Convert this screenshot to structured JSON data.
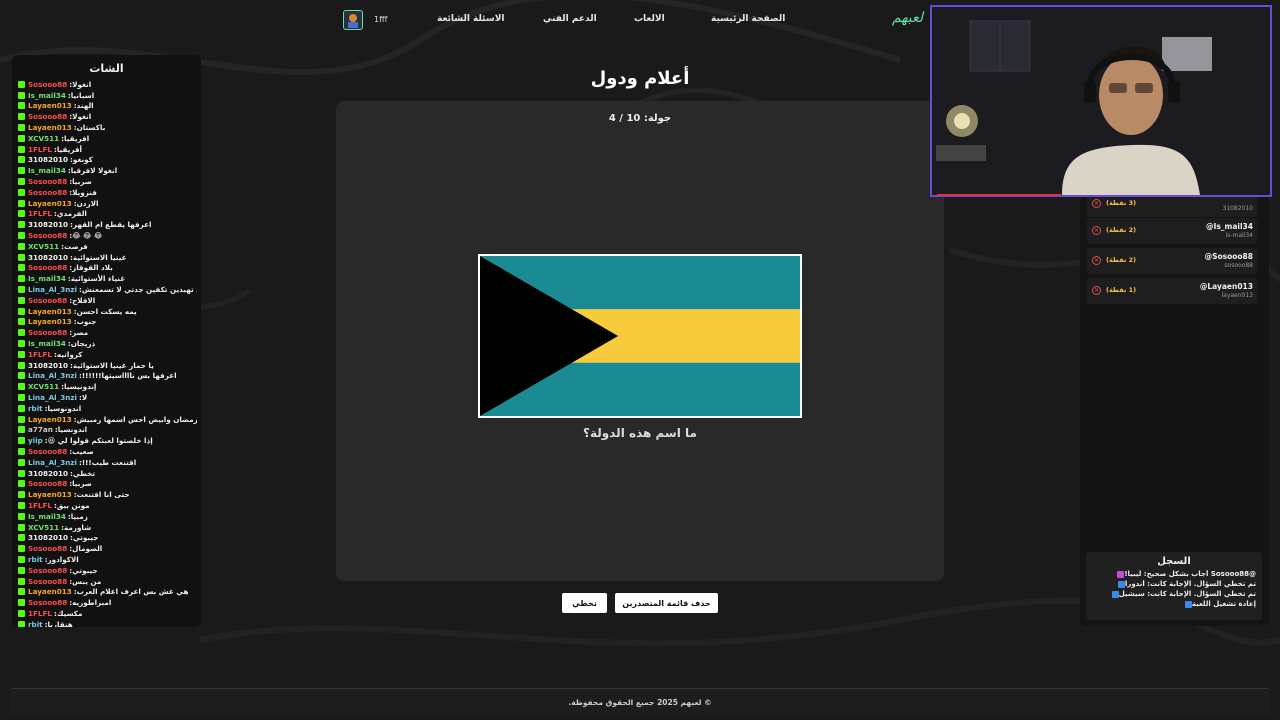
{
  "nav": {
    "logo": "لعبهم",
    "items": [
      "الصفحة الرئيسية",
      "الالعاب",
      "الدعم الفني",
      "الاسئلة الشائعة"
    ],
    "username": "1fff"
  },
  "chat": {
    "title": "الشات",
    "messages": [
      {
        "user": "Sosooo88",
        "text": "انغولا",
        "color": "#ff4d4d"
      },
      {
        "user": "Is_mail34",
        "text": "اسبانيا",
        "color": "#6ee26e"
      },
      {
        "user": "Layaen013",
        "text": "الهند",
        "color": "#f5a623"
      },
      {
        "user": "Sosooo88",
        "text": "انغولا",
        "color": "#ff4d4d"
      },
      {
        "user": "Layaen013",
        "text": "باكستان",
        "color": "#f5a623"
      },
      {
        "user": "XCV511",
        "text": "افريقيا",
        "color": "#6ee26e"
      },
      {
        "user": "1FLFL",
        "text": "أفريقيا",
        "color": "#ff4d4d"
      },
      {
        "user": "31082010",
        "text": "كونغو",
        "color": "#f0f0f0"
      },
      {
        "user": "Is_mail34",
        "text": "انغولا لافرقيا",
        "color": "#6ee26e"
      },
      {
        "user": "Sosooo88",
        "text": "صربيا",
        "color": "#ff4d4d"
      },
      {
        "user": "Sosooo88",
        "text": "فنزويلا",
        "color": "#ff4d4d"
      },
      {
        "user": "Layaen013",
        "text": "الاردن",
        "color": "#f5a623"
      },
      {
        "user": "1FLFL",
        "text": "الفرمدي",
        "color": "#ff4d4d"
      },
      {
        "user": "31082010",
        "text": "اعرفها يقطع ام القهر",
        "color": "#f0f0f0"
      },
      {
        "user": "Sosooo88",
        "text": "😂 😂 😂",
        "color": "#ff4d4d"
      },
      {
        "user": "XCV511",
        "text": "فرصت",
        "color": "#6ee26e"
      },
      {
        "user": "31082010",
        "text": "غينيا الاستوائية",
        "color": "#f0f0f0"
      },
      {
        "user": "Sosooo88",
        "text": "بلاد القوقاز",
        "color": "#ff4d4d"
      },
      {
        "user": "Is_mail34",
        "text": "غنياء الأستوائية",
        "color": "#6ee26e"
      },
      {
        "user": "Lina_Al_3nzi",
        "text": "لعند تهبدين تكفين جدتي لا تسمعنش",
        "color": "#7ec8e3"
      },
      {
        "user": "Sosooo88",
        "text": "الافلاح",
        "color": "#ff4d4d"
      },
      {
        "user": "Layaen013",
        "text": "يمه يسكت احسن",
        "color": "#f5a623"
      },
      {
        "user": "Layaen013",
        "text": "جنوب",
        "color": "#f5a623"
      },
      {
        "user": "Sosooo88",
        "text": "مصر",
        "color": "#ff4d4d"
      },
      {
        "user": "Is_mail34",
        "text": "ذريجان",
        "color": "#6ee26e"
      },
      {
        "user": "1FLFL",
        "text": "كرواتيه",
        "color": "#ff4d4d"
      },
      {
        "user": "31082010",
        "text": "يا حمار غينيا الاستوائية",
        "color": "#f0f0f0"
      },
      {
        "user": "Lina_Al_3nzi",
        "text": "اعرفها بس نااااسيتها!!!!!!",
        "color": "#7ec8e3"
      },
      {
        "user": "XCV511",
        "text": "إندونيسيا",
        "color": "#6ee26e"
      },
      {
        "user": "Lina_Al_3nzi",
        "text": "لا",
        "color": "#7ec8e3"
      },
      {
        "user": "rbit",
        "text": "اندونوسيا",
        "color": "#7ec8e3"
      },
      {
        "user": "Layaen013",
        "text": "رمضان وابيض احس اسمها رمبيش",
        "color": "#f5a623"
      },
      {
        "user": "a77an",
        "text": "اندونسيا",
        "color": "#cccccc"
      },
      {
        "user": "yiip",
        "text": "إذا خلصتوا لعبتكم قولوا لي 😆",
        "color": "#7ec8e3"
      },
      {
        "user": "Sosooo88",
        "text": "صعيب",
        "color": "#ff4d4d"
      },
      {
        "user": "Lina_Al_3nzi",
        "text": "اقتنعت طيب!!!",
        "color": "#7ec8e3"
      },
      {
        "user": "31082010",
        "text": "تخطي",
        "color": "#f0f0f0"
      },
      {
        "user": "Sosooo88",
        "text": "صربيا",
        "color": "#ff4d4d"
      },
      {
        "user": "Layaen013",
        "text": "حتى انا اقتنعت",
        "color": "#f5a623"
      },
      {
        "user": "1FLFL",
        "text": "مونن بيق",
        "color": "#ff4d4d"
      },
      {
        "user": "Is_mail34",
        "text": "زمبيا",
        "color": "#6ee26e"
      },
      {
        "user": "XCV511",
        "text": "شاورمة",
        "color": "#6ee26e"
      },
      {
        "user": "31082010",
        "text": "جيبوتي",
        "color": "#f0f0f0"
      },
      {
        "user": "Sosooo88",
        "text": "الصومال",
        "color": "#ff4d4d"
      },
      {
        "user": "rbit",
        "text": "الاكوادور",
        "color": "#7ec8e3"
      },
      {
        "user": "Sosooo88",
        "text": "جيبوتي",
        "color": "#ff4d4d"
      },
      {
        "user": "Sosooo88",
        "text": "من يبس",
        "color": "#ff4d4d"
      },
      {
        "user": "Layaen013",
        "text": "هي غش بس اعرف اعلام العرب",
        "color": "#f5a623"
      },
      {
        "user": "Sosooo88",
        "text": "امبراطوريه",
        "color": "#ff4d4d"
      },
      {
        "user": "1FLFL",
        "text": "مكسيك",
        "color": "#ff4d4d"
      },
      {
        "user": "rbit",
        "text": "هنقاريا",
        "color": "#7ec8e3"
      }
    ]
  },
  "game": {
    "title": "أعلام ودول",
    "round": "جولة: 10 / 4",
    "question": "ما اسم هذه الدولة؟",
    "flag_colors": {
      "aqua": "#1a8b95",
      "gold": "#f7cb3a",
      "black": "#000000"
    },
    "buttons": {
      "skip": "تخطي",
      "delete_leaderboard": "حذف قائمة المتصدرين"
    }
  },
  "leaderboard": [
    {
      "name": "",
      "handle": "31082010",
      "points": "(3 نقطة)"
    },
    {
      "name": "@Is_mail34",
      "handle": "is-mail34",
      "points": "(2 نقطة)"
    },
    {
      "name": "@Sosooo88",
      "handle": "sosooo88",
      "points": "(2 نقطة)"
    },
    {
      "name": "@Layaen013",
      "handle": "layaen013",
      "points": "(1 نقطة)"
    }
  ],
  "log": {
    "title": "السجل",
    "items": [
      "@Sosooo88 أجاب بشكل صحيح: ليبيا!",
      "تم تخطي السؤال. الإجابة كانت: أندورا",
      "تم تخطي السؤال. الإجابة كانت: سيشيل",
      "إعادة تشغيل اللعبة"
    ]
  },
  "footer": {
    "text": "© لعبهم 2025 جميع الحقوق محفوظة."
  }
}
